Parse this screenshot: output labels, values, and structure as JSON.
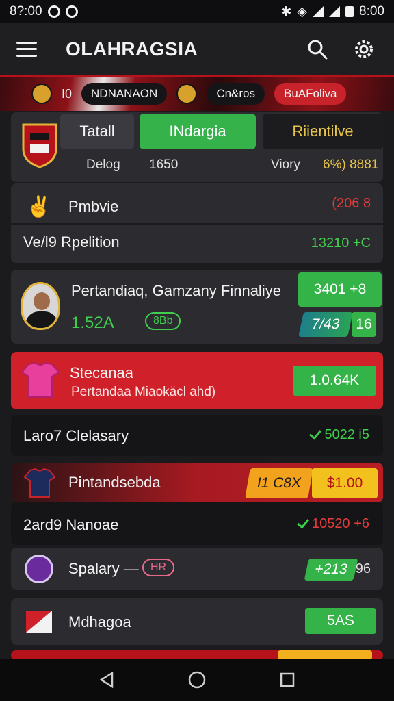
{
  "status": {
    "time": "8?:00",
    "clock_right": "8:00"
  },
  "app": {
    "title": "OLAHRAGSIA"
  },
  "banner": {
    "left_code": "I0",
    "team_a": "NDNANAON",
    "team_b": "Cn&ros",
    "team_c": "BuAFoliva"
  },
  "summary": {
    "tabs": [
      "Tatall",
      "INdargia",
      "Riientilve"
    ],
    "row": {
      "a_label": "Delog",
      "a_value": "1650",
      "b_label": "Viory",
      "b_value": "6%) 8881"
    }
  },
  "cards": {
    "prediction": {
      "title": "Pmbvie",
      "value": "(206 8",
      "sub_label": "Ve/l9 Rpelition",
      "sub_value": "13210 +C"
    },
    "player": {
      "name": "Pertandiaq, Gamzany Finnaliye",
      "stat": "1.52A",
      "badge": "8Bb",
      "odds_main": "3401 +8",
      "odds_a": "7/43",
      "odds_b": "16"
    },
    "jersey": {
      "title": "Stecanaa",
      "subtitle": "Pertandaa Miaokäcl ahd)",
      "value": "1.0.64K"
    },
    "last": {
      "label": "Laro7 Clelasary",
      "value": "5022 i5"
    },
    "pintand": {
      "title": "Pintandsebda",
      "btn_a": "I1 C8X",
      "btn_b": "$1.00"
    },
    "nanoae": {
      "label": "2ard9 Nanoae",
      "value": "10520 +6"
    },
    "spalary": {
      "label": "Spalary —",
      "badge": "HR",
      "odds": "+213",
      "extra": "96"
    },
    "mdhagoa": {
      "label": "Mdhagoa",
      "value": "5AS"
    }
  },
  "colors": {
    "accent_green": "#34b348",
    "accent_red": "#d0202a",
    "gold": "#f2b01e"
  }
}
